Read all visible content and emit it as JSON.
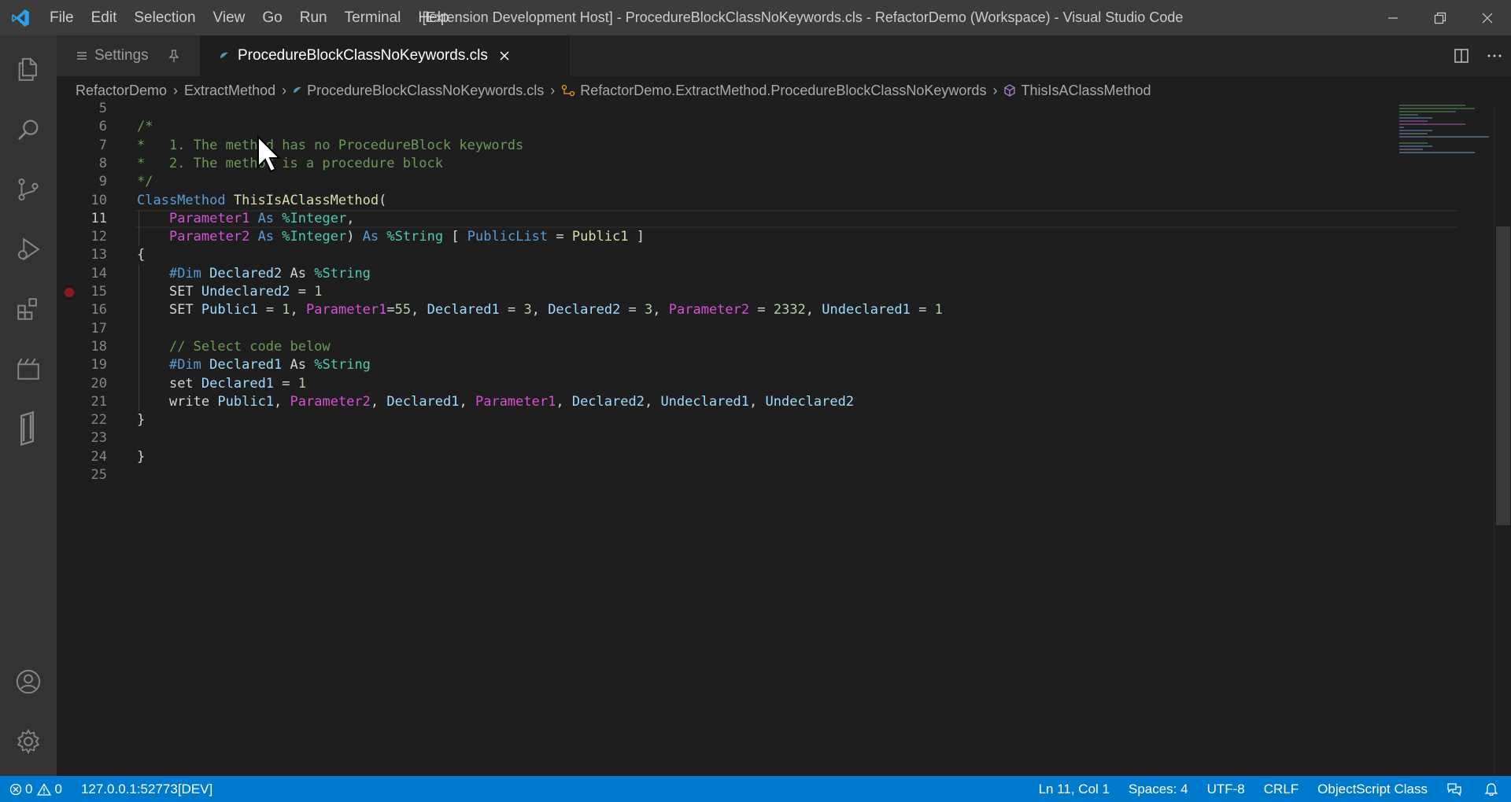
{
  "window": {
    "title": "[Extension Development Host] - ProcedureBlockClassNoKeywords.cls - RefactorDemo (Workspace) - Visual Studio Code",
    "menu": [
      "File",
      "Edit",
      "Selection",
      "View",
      "Go",
      "Run",
      "Terminal",
      "Help"
    ]
  },
  "activity_bar": {
    "items": [
      "explorer-icon",
      "search-icon",
      "source-control-icon",
      "run-debug-icon",
      "extensions-icon",
      "remote-icon",
      "objectscript-icon"
    ],
    "bottom": [
      "accounts-icon",
      "manage-icon"
    ]
  },
  "tabs": [
    {
      "label": "Settings",
      "active": false
    },
    {
      "label": "ProcedureBlockClassNoKeywords.cls",
      "active": true
    }
  ],
  "breadcrumbs": [
    "RefactorDemo",
    "ExtractMethod",
    "ProcedureBlockClassNoKeywords.cls",
    "RefactorDemo.ExtractMethod.ProcedureBlockClassNoKeywords",
    "ThisIsAClassMethod"
  ],
  "editor": {
    "line_numbers": [
      "5",
      "6",
      "7",
      "8",
      "9",
      "10",
      "11",
      "12",
      "13",
      "14",
      "15",
      "16",
      "17",
      "18",
      "19",
      "20",
      "21",
      "22",
      "23",
      "24",
      "25"
    ],
    "current_line": "11",
    "lines": [
      [],
      [
        {
          "t": "/*",
          "c": "comment"
        }
      ],
      [
        {
          "t": "*   1. The method has no ProcedureBlock keywords",
          "c": "comment"
        }
      ],
      [
        {
          "t": "*   2. The method is a procedure block",
          "c": "comment"
        }
      ],
      [
        {
          "t": "*/",
          "c": "comment"
        }
      ],
      [
        {
          "t": "ClassMethod",
          "c": "kw"
        },
        {
          "t": " ",
          "c": "plain"
        },
        {
          "t": "ThisIsAClassMethod",
          "c": "fn"
        },
        {
          "t": "(",
          "c": "plain"
        }
      ],
      [
        {
          "t": "    ",
          "c": "plain"
        },
        {
          "t": "Parameter1",
          "c": "param"
        },
        {
          "t": " ",
          "c": "plain"
        },
        {
          "t": "As",
          "c": "kw"
        },
        {
          "t": " ",
          "c": "plain"
        },
        {
          "t": "%Integer",
          "c": "type"
        },
        {
          "t": ",",
          "c": "plain"
        }
      ],
      [
        {
          "t": "    ",
          "c": "plain"
        },
        {
          "t": "Parameter2",
          "c": "param"
        },
        {
          "t": " ",
          "c": "plain"
        },
        {
          "t": "As",
          "c": "kw"
        },
        {
          "t": " ",
          "c": "plain"
        },
        {
          "t": "%Integer",
          "c": "type"
        },
        {
          "t": ")",
          "c": "plain"
        },
        {
          "t": " ",
          "c": "plain"
        },
        {
          "t": "As",
          "c": "kw"
        },
        {
          "t": " ",
          "c": "plain"
        },
        {
          "t": "%String",
          "c": "type"
        },
        {
          "t": " [ ",
          "c": "plain"
        },
        {
          "t": "PublicList",
          "c": "kw"
        },
        {
          "t": " = ",
          "c": "plain"
        },
        {
          "t": "Public1",
          "c": "fn"
        },
        {
          "t": " ]",
          "c": "plain"
        }
      ],
      [
        {
          "t": "{",
          "c": "plain"
        }
      ],
      [
        {
          "t": "    ",
          "c": "plain"
        },
        {
          "t": "#Dim",
          "c": "kw"
        },
        {
          "t": " ",
          "c": "plain"
        },
        {
          "t": "Declared2",
          "c": "var"
        },
        {
          "t": " ",
          "c": "plain"
        },
        {
          "t": "As",
          "c": "plain"
        },
        {
          "t": " ",
          "c": "plain"
        },
        {
          "t": "%String",
          "c": "type"
        }
      ],
      [
        {
          "t": "    ",
          "c": "plain"
        },
        {
          "t": "SET",
          "c": "plain"
        },
        {
          "t": " ",
          "c": "plain"
        },
        {
          "t": "Undeclared2",
          "c": "var"
        },
        {
          "t": " = ",
          "c": "plain"
        },
        {
          "t": "1",
          "c": "num"
        }
      ],
      [
        {
          "t": "    ",
          "c": "plain"
        },
        {
          "t": "SET",
          "c": "plain"
        },
        {
          "t": " ",
          "c": "plain"
        },
        {
          "t": "Public1",
          "c": "var"
        },
        {
          "t": " = ",
          "c": "plain"
        },
        {
          "t": "1",
          "c": "num"
        },
        {
          "t": ", ",
          "c": "plain"
        },
        {
          "t": "Parameter1",
          "c": "param"
        },
        {
          "t": "=",
          "c": "plain"
        },
        {
          "t": "55",
          "c": "num"
        },
        {
          "t": ", ",
          "c": "plain"
        },
        {
          "t": "Declared1",
          "c": "var"
        },
        {
          "t": " = ",
          "c": "plain"
        },
        {
          "t": "3",
          "c": "num"
        },
        {
          "t": ", ",
          "c": "plain"
        },
        {
          "t": "Declared2",
          "c": "var"
        },
        {
          "t": " = ",
          "c": "plain"
        },
        {
          "t": "3",
          "c": "num"
        },
        {
          "t": ", ",
          "c": "plain"
        },
        {
          "t": "Parameter2",
          "c": "param"
        },
        {
          "t": " = ",
          "c": "plain"
        },
        {
          "t": "2332",
          "c": "num"
        },
        {
          "t": ", ",
          "c": "plain"
        },
        {
          "t": "Undeclared1",
          "c": "var"
        },
        {
          "t": " = ",
          "c": "plain"
        },
        {
          "t": "1",
          "c": "num"
        }
      ],
      [],
      [
        {
          "t": "    ",
          "c": "plain"
        },
        {
          "t": "// Select code below",
          "c": "comment"
        }
      ],
      [
        {
          "t": "    ",
          "c": "plain"
        },
        {
          "t": "#Dim",
          "c": "kw"
        },
        {
          "t": " ",
          "c": "plain"
        },
        {
          "t": "Declared1",
          "c": "var"
        },
        {
          "t": " ",
          "c": "plain"
        },
        {
          "t": "As",
          "c": "plain"
        },
        {
          "t": " ",
          "c": "plain"
        },
        {
          "t": "%String",
          "c": "type"
        }
      ],
      [
        {
          "t": "    ",
          "c": "plain"
        },
        {
          "t": "set",
          "c": "plain"
        },
        {
          "t": " ",
          "c": "plain"
        },
        {
          "t": "Declared1",
          "c": "var"
        },
        {
          "t": " = ",
          "c": "plain"
        },
        {
          "t": "1",
          "c": "num"
        }
      ],
      [
        {
          "t": "    ",
          "c": "plain"
        },
        {
          "t": "write",
          "c": "plain"
        },
        {
          "t": " ",
          "c": "plain"
        },
        {
          "t": "Public1",
          "c": "var"
        },
        {
          "t": ", ",
          "c": "plain"
        },
        {
          "t": "Parameter2",
          "c": "param"
        },
        {
          "t": ", ",
          "c": "plain"
        },
        {
          "t": "Declared1",
          "c": "var"
        },
        {
          "t": ", ",
          "c": "plain"
        },
        {
          "t": "Parameter1",
          "c": "param"
        },
        {
          "t": ", ",
          "c": "plain"
        },
        {
          "t": "Declared2",
          "c": "var"
        },
        {
          "t": ", ",
          "c": "plain"
        },
        {
          "t": "Undeclared1",
          "c": "var"
        },
        {
          "t": ", ",
          "c": "plain"
        },
        {
          "t": "Undeclared2",
          "c": "var"
        }
      ],
      [
        {
          "t": "}",
          "c": "plain"
        }
      ],
      [],
      [
        {
          "t": "}",
          "c": "plain"
        }
      ],
      []
    ],
    "breakpoint_line": "15"
  },
  "status_bar": {
    "errors": "0",
    "warnings": "0",
    "server": "127.0.0.1:52773[DEV]",
    "position": "Ln 11, Col 1",
    "spaces": "Spaces: 4",
    "encoding": "UTF-8",
    "eol": "CRLF",
    "language": "ObjectScript Class"
  },
  "colors": {
    "accent": "#007acc",
    "comment": "#6a9955",
    "keyword": "#569cd6",
    "function": "#dcdcaa",
    "parameter": "#d450d4",
    "type": "#4ec9b0",
    "variable": "#9cdcfe",
    "number": "#b5cea8"
  }
}
